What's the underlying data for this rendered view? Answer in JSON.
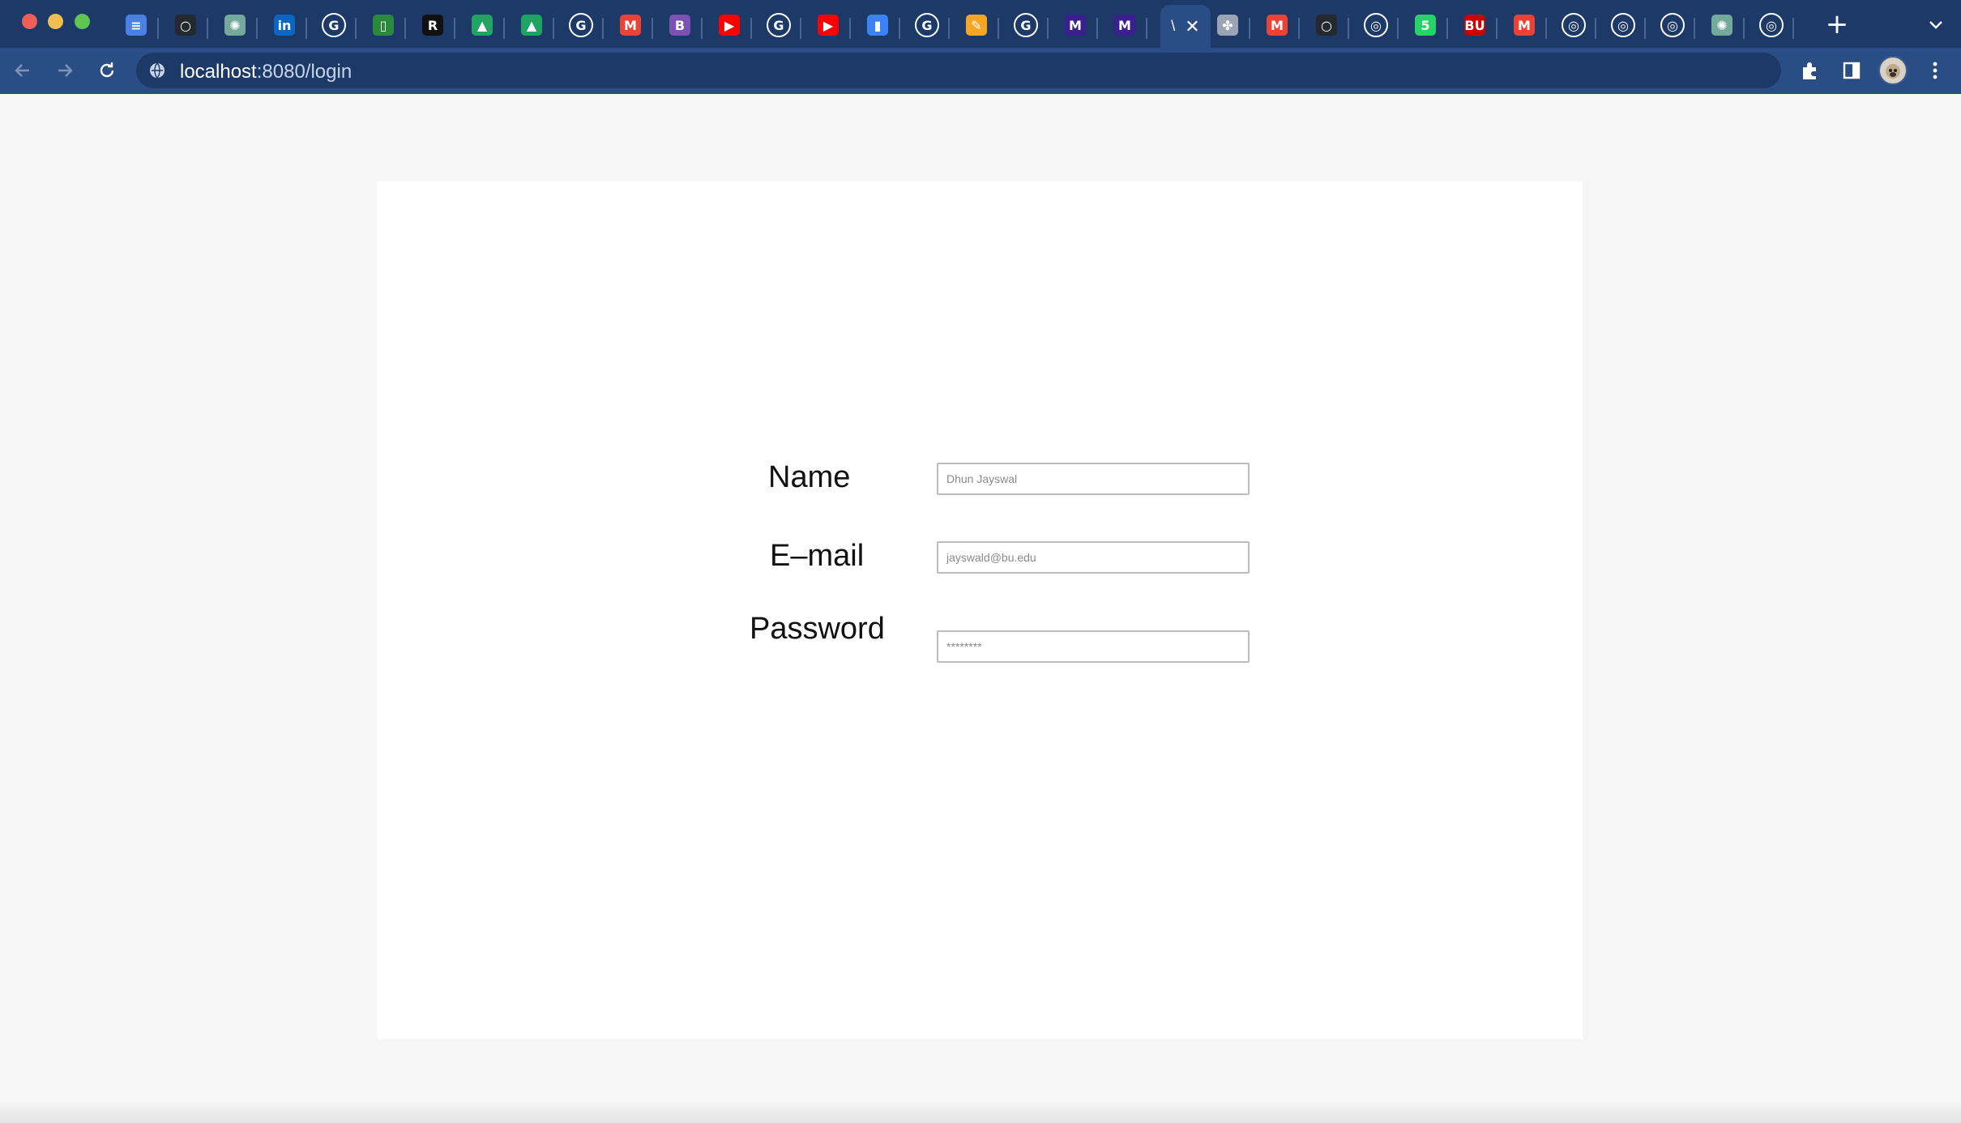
{
  "browser": {
    "url_host": "localhost",
    "url_path": ":8080/login",
    "active_tab_glyph": "\\",
    "tabs": [
      {
        "icon": "google-docs-icon",
        "color": "#4a7fe5",
        "glyph": "≡"
      },
      {
        "icon": "github-icon",
        "color": "#24292f",
        "glyph": "○"
      },
      {
        "icon": "chatgpt-icon",
        "color": "#74aa9c",
        "glyph": "✺"
      },
      {
        "icon": "linkedin-icon",
        "color": "#0a66c2",
        "glyph": "in"
      },
      {
        "icon": "google-icon",
        "color": "#ffffff",
        "glyph": "G"
      },
      {
        "icon": "phone-icon",
        "color": "#2a8a3c",
        "glyph": "▯"
      },
      {
        "icon": "r-icon",
        "color": "#111111",
        "glyph": "R"
      },
      {
        "icon": "google-drive-icon",
        "color": "#1fa463",
        "glyph": "▲"
      },
      {
        "icon": "google-drive-icon",
        "color": "#1fa463",
        "glyph": "▲"
      },
      {
        "icon": "google-icon",
        "color": "#ffffff",
        "glyph": "G"
      },
      {
        "icon": "gmail-icon",
        "color": "#ea4335",
        "glyph": "M"
      },
      {
        "icon": "bootstrap-icon",
        "color": "#7952b3",
        "glyph": "B"
      },
      {
        "icon": "youtube-icon",
        "color": "#ff0000",
        "glyph": "▶"
      },
      {
        "icon": "google-icon",
        "color": "#ffffff",
        "glyph": "G"
      },
      {
        "icon": "youtube-icon",
        "color": "#ff0000",
        "glyph": "▶"
      },
      {
        "icon": "analytics-icon",
        "color": "#3b82f6",
        "glyph": "▮"
      },
      {
        "icon": "google-icon",
        "color": "#ffffff",
        "glyph": "G"
      },
      {
        "icon": "notes-icon",
        "color": "#f4a623",
        "glyph": "✎"
      },
      {
        "icon": "google-icon",
        "color": "#ffffff",
        "glyph": "G"
      },
      {
        "icon": "m-icon",
        "color": "#3b1f8f",
        "glyph": "M"
      },
      {
        "icon": "m-icon",
        "color": "#3b1f8f",
        "glyph": "M"
      },
      {
        "icon": "figma-icon",
        "color": "#9aa4b5",
        "glyph": "✤"
      },
      {
        "icon": "gmail-icon",
        "color": "#ea4335",
        "glyph": "M"
      },
      {
        "icon": "github-icon",
        "color": "#24292f",
        "glyph": "○"
      },
      {
        "icon": "chrome-icon",
        "color": "#ffffff",
        "glyph": "◎"
      },
      {
        "icon": "whatsapp-icon",
        "color": "#25d366",
        "glyph": "5"
      },
      {
        "icon": "bu-icon",
        "color": "#cc0000",
        "glyph": "BU"
      },
      {
        "icon": "gmail-icon",
        "color": "#ea4335",
        "glyph": "M"
      },
      {
        "icon": "chrome-icon",
        "color": "#ffffff",
        "glyph": "◎"
      },
      {
        "icon": "chrome-icon",
        "color": "#ffffff",
        "glyph": "◎"
      },
      {
        "icon": "chrome-icon",
        "color": "#ffffff",
        "glyph": "◎"
      },
      {
        "icon": "chatgpt-icon",
        "color": "#74aa9c",
        "glyph": "✺"
      },
      {
        "icon": "chrome-icon",
        "color": "#ffffff",
        "glyph": "◎"
      }
    ]
  },
  "form": {
    "name_label": "Name",
    "name_placeholder": "Dhun Jayswal",
    "email_label": "E–mail",
    "email_placeholder": "jayswald@bu.edu",
    "password_label": "Password",
    "password_placeholder": "********"
  },
  "colors": {
    "tabstrip": "#1c3968",
    "toolbar": "#2b4d85",
    "page_background": "#f6f6f6",
    "card_background": "#ffffff"
  }
}
